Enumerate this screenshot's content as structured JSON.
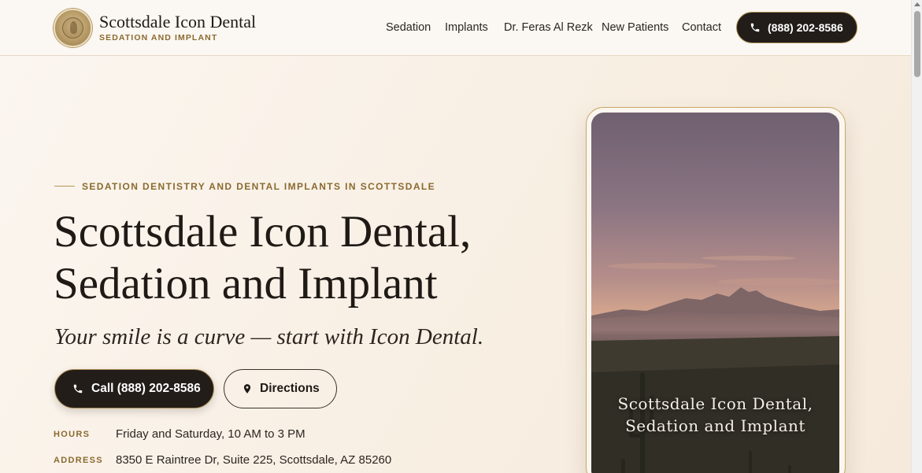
{
  "brand": {
    "name": "Scottsdale Icon Dental",
    "subtitle": "SEDATION AND IMPLANT"
  },
  "nav": {
    "items": [
      "Sedation",
      "Implants",
      "Dr. Feras Al Rezk",
      "New Patients",
      "Contact"
    ],
    "phone_label": "(888) 202-8586"
  },
  "hero": {
    "eyebrow": "SEDATION DENTISTRY AND DENTAL IMPLANTS IN SCOTTSDALE",
    "title_line1": "Scottsdale Icon Dental,",
    "title_line2": "Sedation and Implant",
    "tagline": "Your smile is a curve — start with Icon Dental.",
    "call_button": "Call (888) 202-8586",
    "directions_button": "Directions"
  },
  "info": {
    "hours_label": "HOURS",
    "hours_value": "Friday and Saturday, 10 AM to 3 PM",
    "address_label": "ADDRESS",
    "address_value": "8350 E Raintree Dr, Suite 225, Scottsdale, AZ 85260"
  },
  "image_card": {
    "caption_line1": "Scottsdale Icon Dental,",
    "caption_line2": "Sedation and Implant"
  },
  "icons": {
    "phone": "phone-icon",
    "directions": "map-pin-icon",
    "logo": "logo-seal-icon"
  },
  "colors": {
    "accent_gold": "#8b6a2f",
    "dark_button": "#221d19",
    "background": "#fbf6f0"
  }
}
